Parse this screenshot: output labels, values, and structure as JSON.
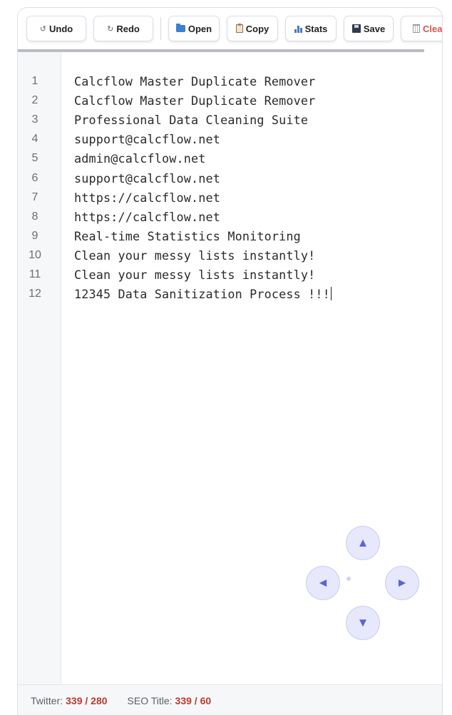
{
  "toolbar": {
    "undo_icon": "↺",
    "undo": "Undo",
    "redo_icon": "↻",
    "redo": "Redo",
    "open": "Open",
    "copy": "Copy",
    "stats": "Stats",
    "save": "Save",
    "clear": "Clea"
  },
  "editor": {
    "line_numbers": [
      "1",
      "2",
      "3",
      "4",
      "5",
      "6",
      "7",
      "8",
      "9",
      "10",
      "11",
      "12"
    ],
    "lines": [
      "Calcflow Master Duplicate Remover",
      "Calcflow Master Duplicate Remover",
      "Professional Data Cleaning Suite",
      "support@calcflow.net",
      "admin@calcflow.net",
      "support@calcflow.net",
      "https://calcflow.net",
      "https://calcflow.net",
      "Real-time Statistics Monitoring",
      "Clean your messy lists instantly!",
      "Clean your messy lists instantly!",
      "12345 Data Sanitization Process !!!"
    ]
  },
  "dpad": {
    "up": "▲",
    "left": "◄",
    "right": "►",
    "down": "▼"
  },
  "footer": {
    "twitter_label": "Twitter:",
    "twitter_value": "339 / 280",
    "seo_label": "SEO Title:",
    "seo_value": "339 / 60"
  },
  "colors": {
    "accent": "#5b63d8",
    "warning": "#c0392b",
    "clear": "#d9534f"
  }
}
